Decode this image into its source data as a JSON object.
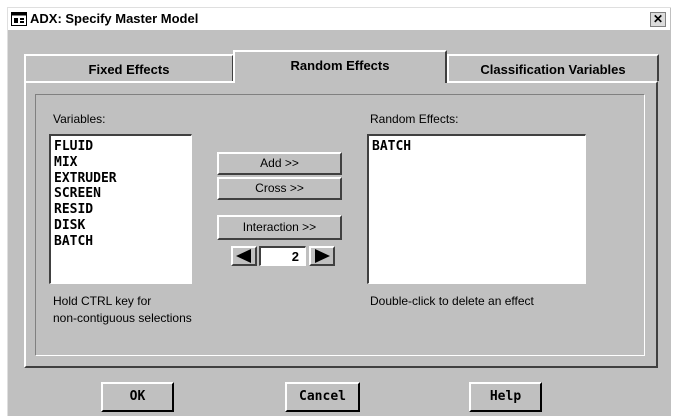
{
  "window": {
    "title": "ADX: Specify Master Model",
    "close_glyph": "✕"
  },
  "tabs": [
    {
      "label": "Fixed Effects",
      "active": false
    },
    {
      "label": "Random Effects",
      "active": true
    },
    {
      "label": "Classification Variables",
      "active": false
    }
  ],
  "variables": {
    "label": "Variables:",
    "items": [
      "FLUID",
      "MIX",
      "EXTRUDER",
      "SCREEN",
      "RESID",
      "DISK",
      "BATCH"
    ],
    "hint_line1": "Hold CTRL key for",
    "hint_line2": "non-contiguous selections"
  },
  "effects": {
    "label": "Random Effects:",
    "items": [
      "BATCH"
    ],
    "hint": "Double-click to delete an effect"
  },
  "actions": {
    "add_label": "Add >>",
    "cross_label": "Cross >>",
    "interaction_label": "Interaction >>",
    "interaction_order": "2"
  },
  "footer": {
    "ok_label": "OK",
    "cancel_label": "Cancel",
    "help_label": "Help"
  },
  "icons": {
    "title": "app-window-icon",
    "left": "triangle-left-icon",
    "right": "triangle-right-icon"
  }
}
